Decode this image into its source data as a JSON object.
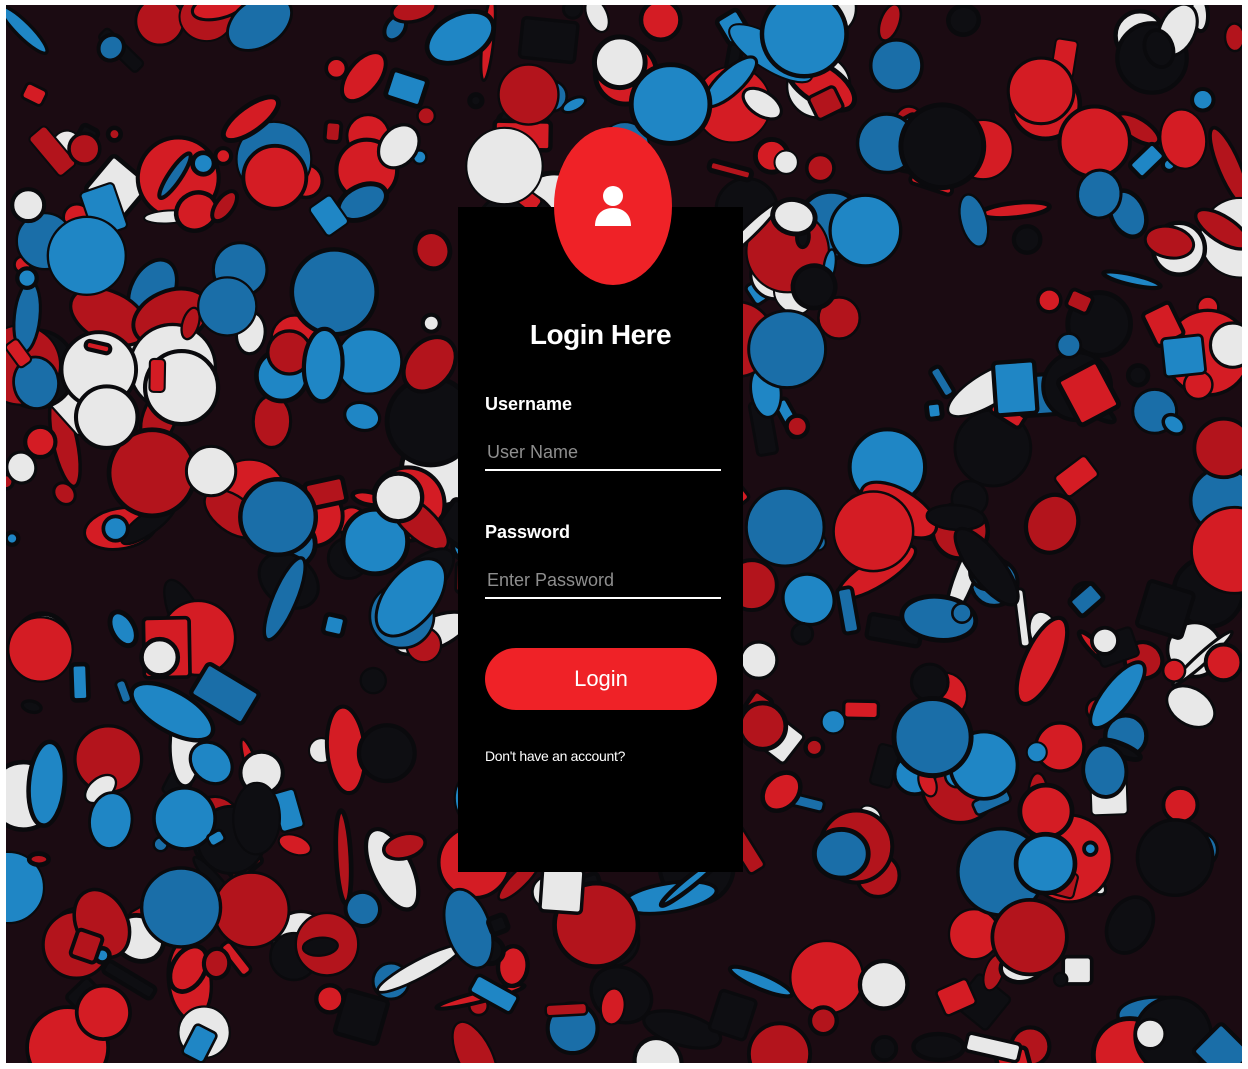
{
  "login": {
    "title": "Login Here",
    "username_label": "Username",
    "username_placeholder": "User Name",
    "password_label": "Password",
    "password_placeholder": "Enter Password",
    "button_label": "Login",
    "signup_link": "Don't have an account?"
  },
  "icons": {
    "avatar": "user-icon"
  },
  "colors": {
    "accent": "#ef2227",
    "card": "#000000",
    "background_red": "#d41c24",
    "background_blue": "#1f86c5"
  }
}
